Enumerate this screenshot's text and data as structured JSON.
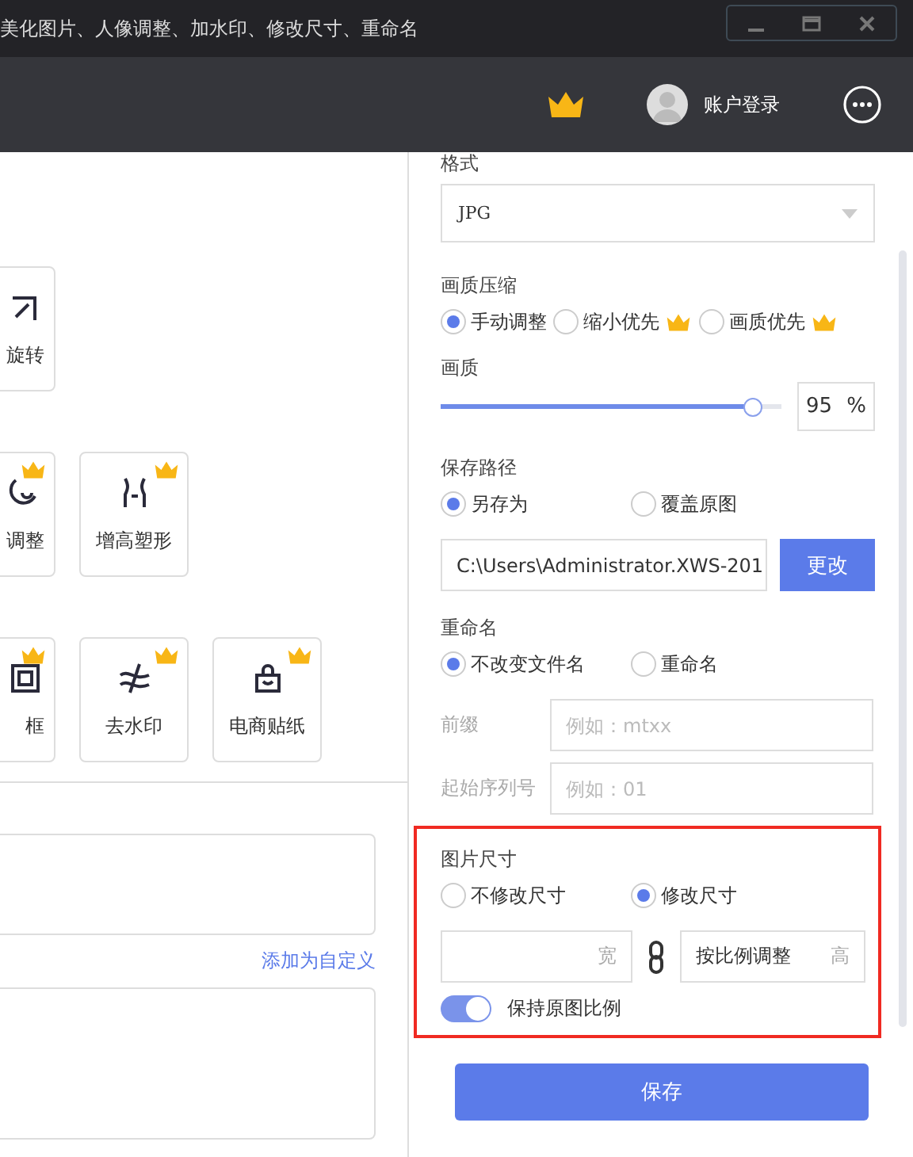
{
  "title_bar": {
    "title": "美化图片、人像调整、加水印、修改尺寸、重命名"
  },
  "toolbar": {
    "account": "账户登录"
  },
  "tool_rows": [
    [
      {
        "label": "旋转",
        "vip": false
      }
    ],
    [
      {
        "label": "调整",
        "vip": true
      },
      {
        "label": "增高塑形",
        "vip": true
      }
    ],
    [
      {
        "label": "框",
        "vip": true
      },
      {
        "label": "去水印",
        "vip": true
      },
      {
        "label": "电商贴纸",
        "vip": true
      }
    ]
  ],
  "custom_link": "添加为自定义",
  "settings": {
    "format": {
      "label": "格式",
      "value": "JPG"
    },
    "compression": {
      "label": "画质压缩",
      "options": [
        {
          "label": "手动调整",
          "selected": true,
          "vip": false
        },
        {
          "label": "缩小优先",
          "selected": false,
          "vip": true
        },
        {
          "label": "画质优先",
          "selected": false,
          "vip": true
        }
      ]
    },
    "quality": {
      "label": "画质",
      "level": 0.92,
      "value": "95",
      "unit": "%"
    },
    "save_path": {
      "label": "保存路径",
      "options": [
        {
          "label": "另存为",
          "selected": true
        },
        {
          "label": "覆盖原图",
          "selected": false
        }
      ],
      "path": "C:\\Users\\Administrator.XWS-201",
      "button": "更改"
    },
    "rename": {
      "label": "重命名",
      "options": [
        {
          "label": "不改变文件名",
          "selected": true
        },
        {
          "label": "重命名",
          "selected": false
        }
      ],
      "fields": [
        {
          "label": "前缀",
          "placeholder": "例如：mtxx"
        },
        {
          "label": "起始序列号",
          "placeholder": "例如：01"
        }
      ]
    },
    "size": {
      "label": "图片尺寸",
      "options": [
        {
          "label": "不修改尺寸",
          "selected": false
        },
        {
          "label": "修改尺寸",
          "selected": true
        }
      ],
      "width_unit": "宽",
      "height_value": "按比例调整",
      "height_unit": "高",
      "keep_ratio": {
        "label": "保持原图比例",
        "on": true
      }
    },
    "save_button": "保存"
  }
}
